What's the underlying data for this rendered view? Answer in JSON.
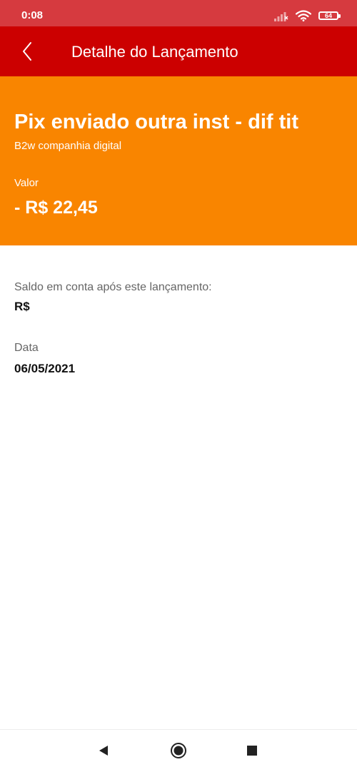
{
  "status_bar": {
    "time": "0:08",
    "battery": "64",
    "icons": [
      "signal-icon",
      "wifi-icon",
      "battery-icon"
    ]
  },
  "header": {
    "title": "Detalhe do Lançamento",
    "back_icon": "back-arrow-icon"
  },
  "transaction": {
    "title": "Pix enviado outra inst - dif tit",
    "subtitle": "B2w companhia digital",
    "value_label": "Valor",
    "value": "- R$ 22,45"
  },
  "details": {
    "balance_label": "Saldo em conta após este lançamento:",
    "balance_value": "R$",
    "date_label": "Data",
    "date_value": "06/05/2021"
  },
  "navigation": {
    "icons": [
      "back-triangle-icon",
      "home-circle-icon",
      "recents-square-icon"
    ]
  },
  "colors": {
    "status_bar": "#d63a3f",
    "app_bar": "#cc0000",
    "hero": "#f98500"
  }
}
